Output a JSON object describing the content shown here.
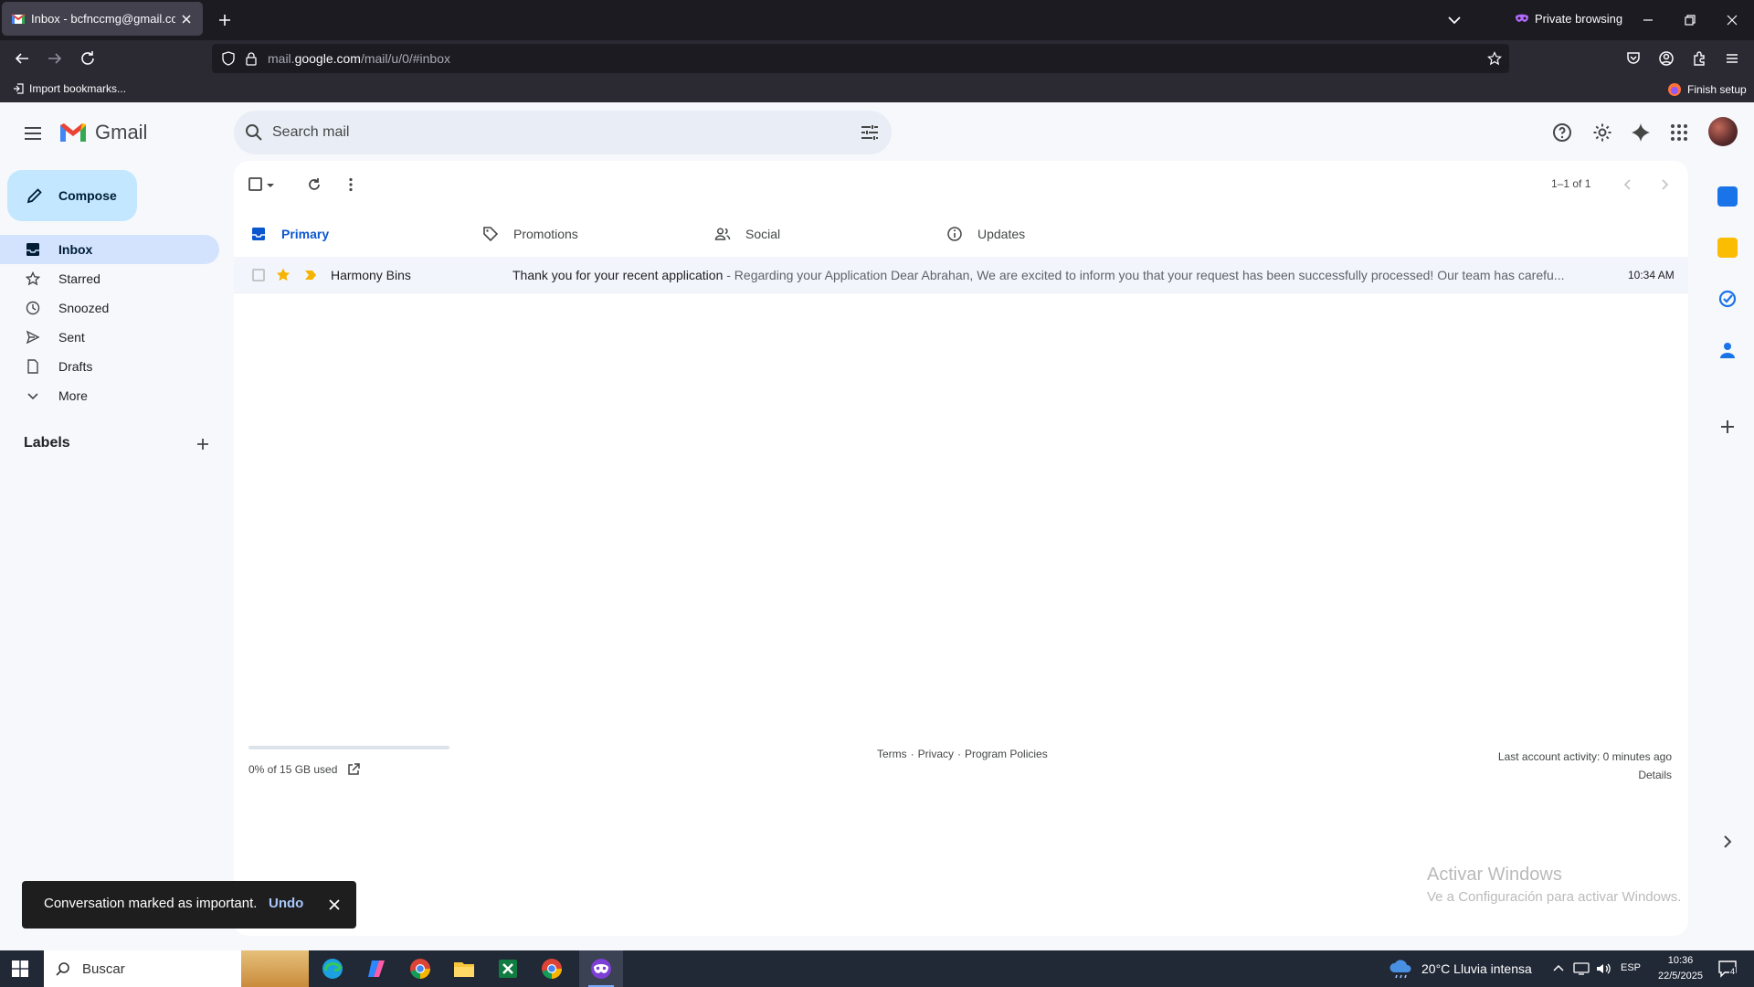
{
  "browser": {
    "tab_title": "Inbox - bcfnccmg@gmail.com -",
    "private_label": "Private browsing",
    "url_prefix": "mail.",
    "url_domain": "google.com",
    "url_path": "/mail/u/0/#inbox",
    "bookmark_import": "Import bookmarks...",
    "finish_setup": "Finish setup"
  },
  "gmail": {
    "logo_text": "Gmail",
    "search_placeholder": "Search mail",
    "compose_label": "Compose",
    "nav": [
      {
        "label": "Inbox",
        "icon": "inbox-icon"
      },
      {
        "label": "Starred",
        "icon": "star-icon"
      },
      {
        "label": "Snoozed",
        "icon": "clock-icon"
      },
      {
        "label": "Sent",
        "icon": "send-icon"
      },
      {
        "label": "Drafts",
        "icon": "draft-icon"
      },
      {
        "label": "More",
        "icon": "chevron-down-icon"
      }
    ],
    "labels_heading": "Labels",
    "pager": "1–1 of 1",
    "tabs": [
      {
        "label": "Primary",
        "icon": "inbox-icon"
      },
      {
        "label": "Promotions",
        "icon": "tag-icon"
      },
      {
        "label": "Social",
        "icon": "people-icon"
      },
      {
        "label": "Updates",
        "icon": "info-icon"
      }
    ],
    "emails": [
      {
        "sender": "Harmony Bins",
        "subject": "Thank you for your recent application",
        "snippet": " - Regarding your Application Dear Abrahan, We are excited to inform you that your request has been successfully processed! Our team has carefu...",
        "time": "10:34 AM",
        "starred": true,
        "important": true
      }
    ],
    "storage_text": "0% of 15 GB used",
    "storage_fraction": 0.0,
    "footer": {
      "terms": "Terms",
      "sep": "·",
      "privacy": "Privacy",
      "policies": "Program Policies"
    },
    "activity": "Last account activity: 0 minutes ago",
    "details": "Details",
    "snackbar": {
      "message": "Conversation marked as important.",
      "action": "Undo"
    }
  },
  "watermark": {
    "line1": "Activar Windows",
    "line2": "Ve a Configuración para activar Windows."
  },
  "taskbar": {
    "search_label": "Buscar",
    "weather": "20°C  Lluvia intensa",
    "lang": "ESP",
    "time": "10:36",
    "date": "22/5/2025",
    "notifications": "4"
  },
  "colors": {
    "accent": "#0b57d0",
    "compose_bg": "#c2e7ff",
    "active_nav": "#d3e3fd",
    "star": "#f4b400"
  }
}
